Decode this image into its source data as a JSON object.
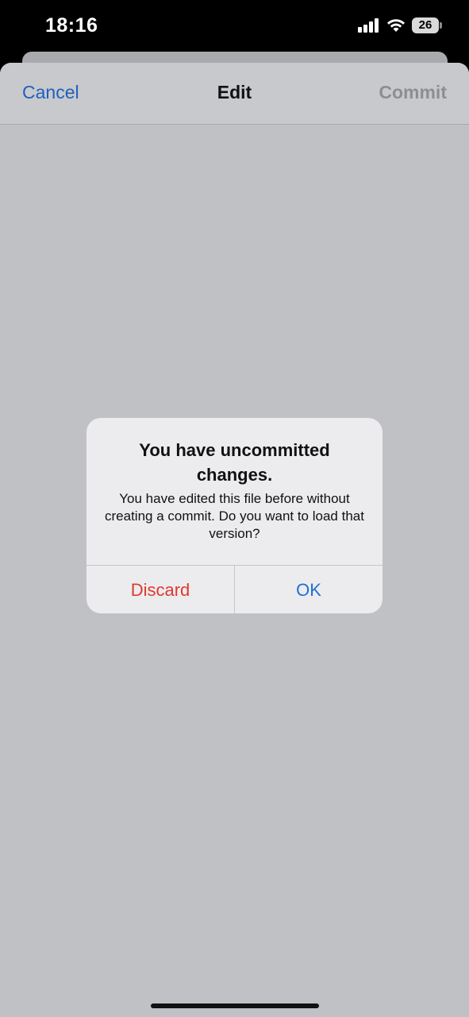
{
  "status_bar": {
    "time": "18:16",
    "battery_level": "26",
    "icons": [
      "signal-icon",
      "wifi-icon",
      "battery-icon"
    ]
  },
  "nav": {
    "cancel_label": "Cancel",
    "title": "Edit",
    "commit_label": "Commit"
  },
  "alert": {
    "title": "You have uncommitted changes.",
    "message": "You have edited this file before without creating a commit. Do you want to load that version?",
    "discard_label": "Discard",
    "ok_label": "OK"
  },
  "colors": {
    "accent_blue": "#1f5fbf",
    "destructive_red": "#e0392e",
    "disabled_gray": "#8d8e92",
    "sheet_background": "#c0c1c5",
    "alert_background": "#ececee"
  }
}
